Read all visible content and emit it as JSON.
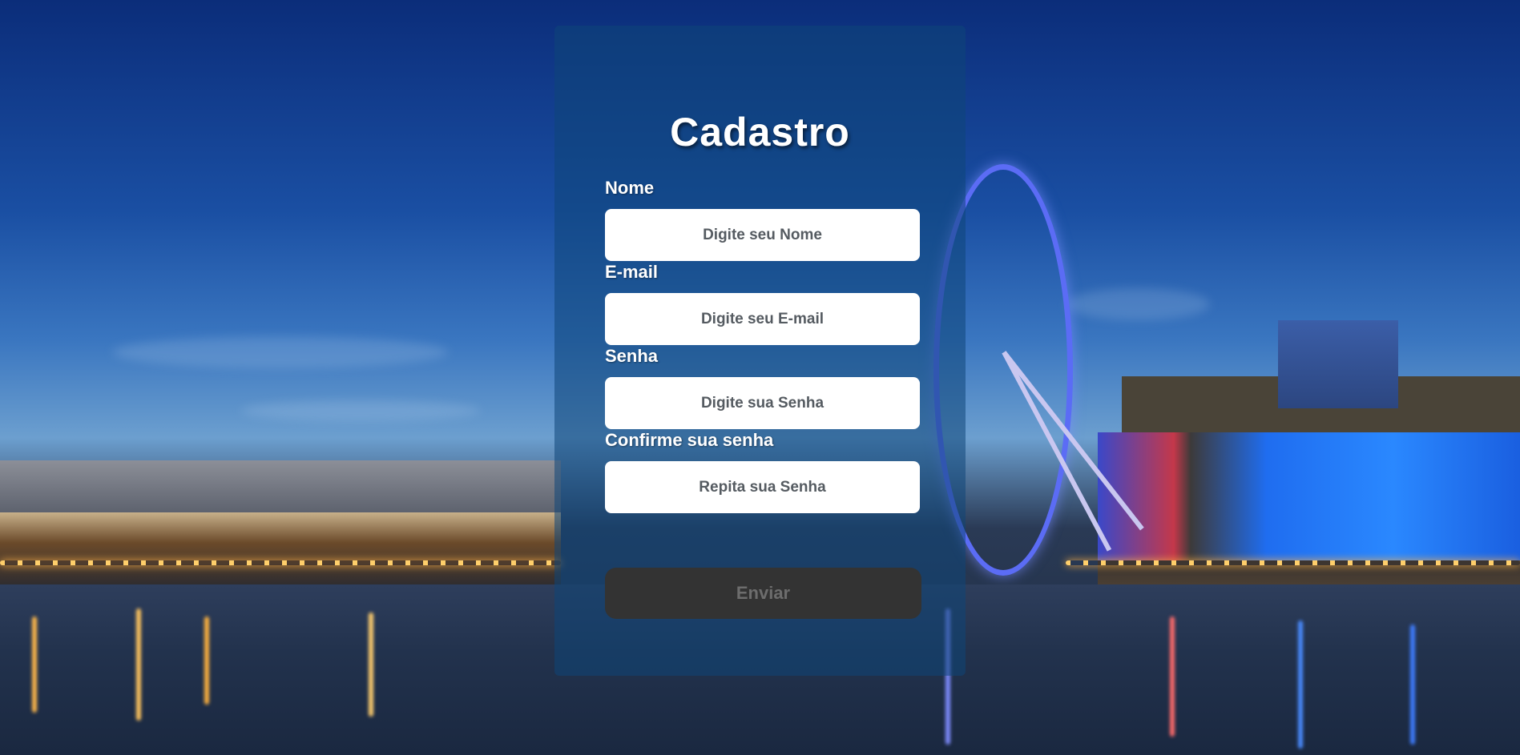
{
  "form": {
    "title": "Cadastro",
    "fields": [
      {
        "label": "Nome",
        "placeholder": "Digite seu Nome"
      },
      {
        "label": "E-mail",
        "placeholder": "Digite seu E-mail"
      },
      {
        "label": "Senha",
        "placeholder": "Digite sua Senha"
      },
      {
        "label": "Confirme sua senha",
        "placeholder": "Repita sua Senha"
      }
    ],
    "submit_label": "Enviar"
  },
  "colors": {
    "panel": "#0f4678",
    "input_background": "#ffffff",
    "button_background": "#333333",
    "button_text": "#6d6d6d",
    "text": "#ffffff"
  }
}
